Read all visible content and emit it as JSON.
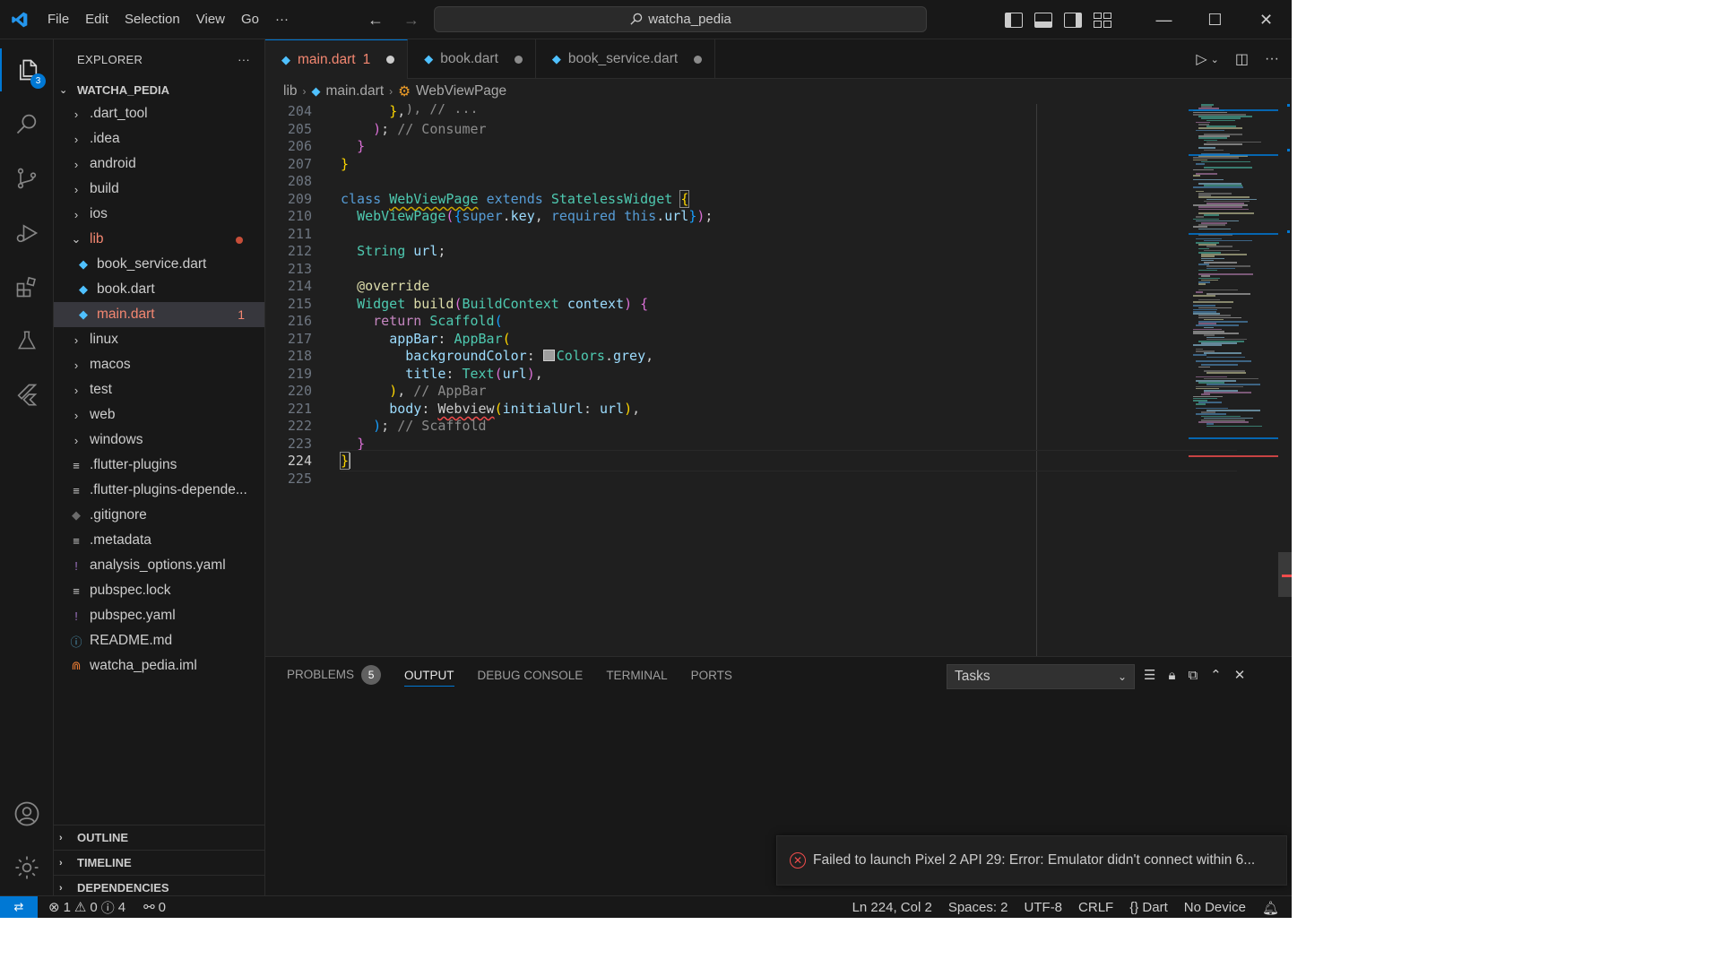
{
  "titlebar": {
    "menu": [
      "File",
      "Edit",
      "Selection",
      "View",
      "Go"
    ],
    "more": "···",
    "search_text": "watcha_pedia",
    "window_controls": [
      "minimize-icon",
      "maximize-icon",
      "close-icon"
    ]
  },
  "activity": {
    "explorer_badge": "3"
  },
  "sidebar": {
    "header": "EXPLORER",
    "more": "···",
    "project": "WATCHA_PEDIA",
    "items": [
      {
        "label": ".dart_tool",
        "kind": "folder"
      },
      {
        "label": ".idea",
        "kind": "folder"
      },
      {
        "label": "android",
        "kind": "folder"
      },
      {
        "label": "build",
        "kind": "folder"
      },
      {
        "label": "ios",
        "kind": "folder"
      },
      {
        "label": "lib",
        "kind": "folder-open"
      },
      {
        "label": "book_service.dart",
        "kind": "dart"
      },
      {
        "label": "book.dart",
        "kind": "dart"
      },
      {
        "label": "main.dart",
        "kind": "dart",
        "count": "1"
      },
      {
        "label": "linux",
        "kind": "folder"
      },
      {
        "label": "macos",
        "kind": "folder"
      },
      {
        "label": "test",
        "kind": "folder"
      },
      {
        "label": "web",
        "kind": "folder"
      },
      {
        "label": "windows",
        "kind": "folder"
      },
      {
        "label": ".flutter-plugins",
        "kind": "file"
      },
      {
        "label": ".flutter-plugins-depende...",
        "kind": "file"
      },
      {
        "label": ".gitignore",
        "kind": "git"
      },
      {
        "label": ".metadata",
        "kind": "file"
      },
      {
        "label": "analysis_options.yaml",
        "kind": "yaml"
      },
      {
        "label": "pubspec.lock",
        "kind": "file"
      },
      {
        "label": "pubspec.yaml",
        "kind": "yaml"
      },
      {
        "label": "README.md",
        "kind": "info"
      },
      {
        "label": "watcha_pedia.iml",
        "kind": "rss"
      }
    ],
    "sections": [
      "OUTLINE",
      "TIMELINE",
      "DEPENDENCIES"
    ]
  },
  "tabs": [
    {
      "label": "main.dart",
      "problems": "1"
    },
    {
      "label": "book.dart"
    },
    {
      "label": "book_service.dart"
    }
  ],
  "breadcrumb": [
    "lib",
    "main.dart",
    "WebViewPage"
  ],
  "editor": {
    "line_numbers": [
      "204",
      "205",
      "206",
      "207",
      "208",
      "209",
      "210",
      "211",
      "212",
      "213",
      "214",
      "215",
      "216",
      "217",
      "218",
      "219",
      "220",
      "221",
      "222",
      "223",
      "224",
      "225"
    ],
    "current_line": "224"
  },
  "panel": {
    "tabs": [
      "PROBLEMS",
      "OUTPUT",
      "DEBUG CONSOLE",
      "TERMINAL",
      "PORTS"
    ],
    "problems_count": "5",
    "active_tab": "OUTPUT",
    "select_value": "Tasks"
  },
  "toast": {
    "message": "Failed to launch Pixel 2 API 29: Error: Emulator didn't connect within 6..."
  },
  "status": {
    "errors": "1",
    "warnings": "0",
    "infos": "4",
    "ports": "0",
    "position": "Ln 224, Col 2",
    "spaces": "Spaces: 2",
    "encoding": "UTF-8",
    "eol": "CRLF",
    "language": "Dart",
    "device": "No Device"
  },
  "colors": {
    "accent": "#0078d4",
    "error": "#f14c4c",
    "editor_bg": "#1f1f1f",
    "sidebar_bg": "#181818"
  }
}
